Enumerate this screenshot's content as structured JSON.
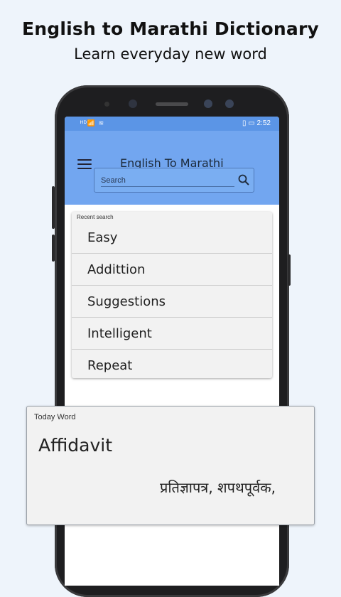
{
  "banner": {
    "headline": "English to Marathi Dictionary",
    "subline": "Learn everyday new word"
  },
  "statusbar": {
    "left_icons": "ᴴᴰ📶 ≋",
    "battery_icons": "▯ ▭",
    "time": "2:52"
  },
  "appbar": {
    "title": "English To Marathi",
    "menu_icon": "menu-icon"
  },
  "search": {
    "placeholder": "Search",
    "icon": "search-icon"
  },
  "recent": {
    "label": "Recent search",
    "items": [
      "Easy",
      "Addittion",
      "Suggestions",
      "Intelligent",
      "Repeat"
    ]
  },
  "today": {
    "label": "Today Word",
    "word": "Affidavit",
    "meaning": "प्रतिज्ञापत्र, शपथपूर्वक,"
  },
  "colors": {
    "statusbar": "#5b95e6",
    "appbar": "#72a6f0",
    "background": "#eef4fb"
  }
}
